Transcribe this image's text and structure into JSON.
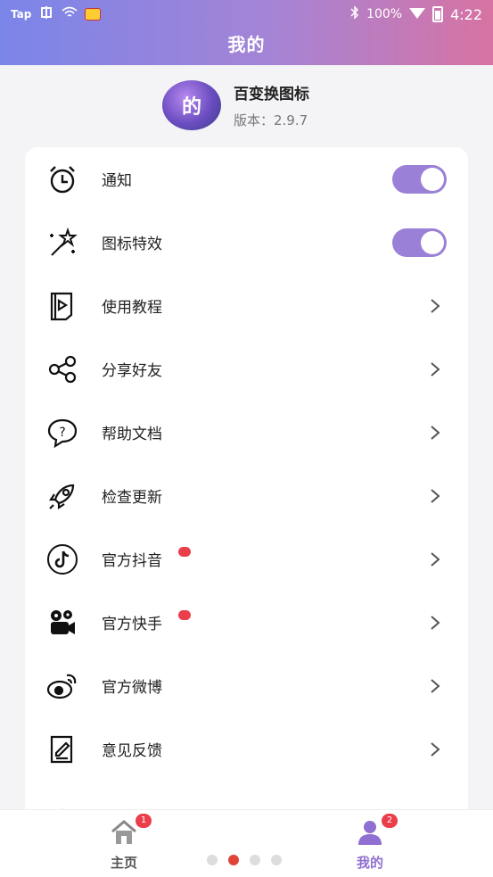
{
  "status": {
    "carrier": "Tap",
    "battery": "100%",
    "time": "4:22"
  },
  "header": {
    "title": "我的"
  },
  "app": {
    "name": "百变换图标",
    "version": "版本：2.9.7",
    "logo_glyph": "的"
  },
  "menu": [
    {
      "label": "通知",
      "icon": "alarm-clock-icon",
      "control": "toggle",
      "on": true
    },
    {
      "label": "图标特效",
      "icon": "magic-wand-icon",
      "control": "toggle",
      "on": true
    },
    {
      "label": "使用教程",
      "icon": "video-guide-icon",
      "control": "chevron"
    },
    {
      "label": "分享好友",
      "icon": "share-icon",
      "control": "chevron"
    },
    {
      "label": "帮助文档",
      "icon": "help-bubble-icon",
      "control": "chevron"
    },
    {
      "label": "检查更新",
      "icon": "rocket-icon",
      "control": "chevron"
    },
    {
      "label": "官方抖音",
      "icon": "tiktok-icon",
      "control": "chevron",
      "dot": true
    },
    {
      "label": "官方快手",
      "icon": "kuaishou-icon",
      "control": "chevron",
      "dot": true
    },
    {
      "label": "官方微博",
      "icon": "weibo-icon",
      "control": "chevron"
    },
    {
      "label": "意见反馈",
      "icon": "feedback-icon",
      "control": "chevron"
    }
  ],
  "nav": {
    "home": {
      "label": "主页",
      "badge": "1"
    },
    "mine": {
      "label": "我的",
      "badge": "2"
    },
    "page_dots": 4,
    "active_dot": 1
  },
  "colors": {
    "accent": "#9b80d8",
    "badge": "#ea3e4a",
    "active_nav": "#8f6fd1",
    "inactive_nav": "#555555"
  }
}
